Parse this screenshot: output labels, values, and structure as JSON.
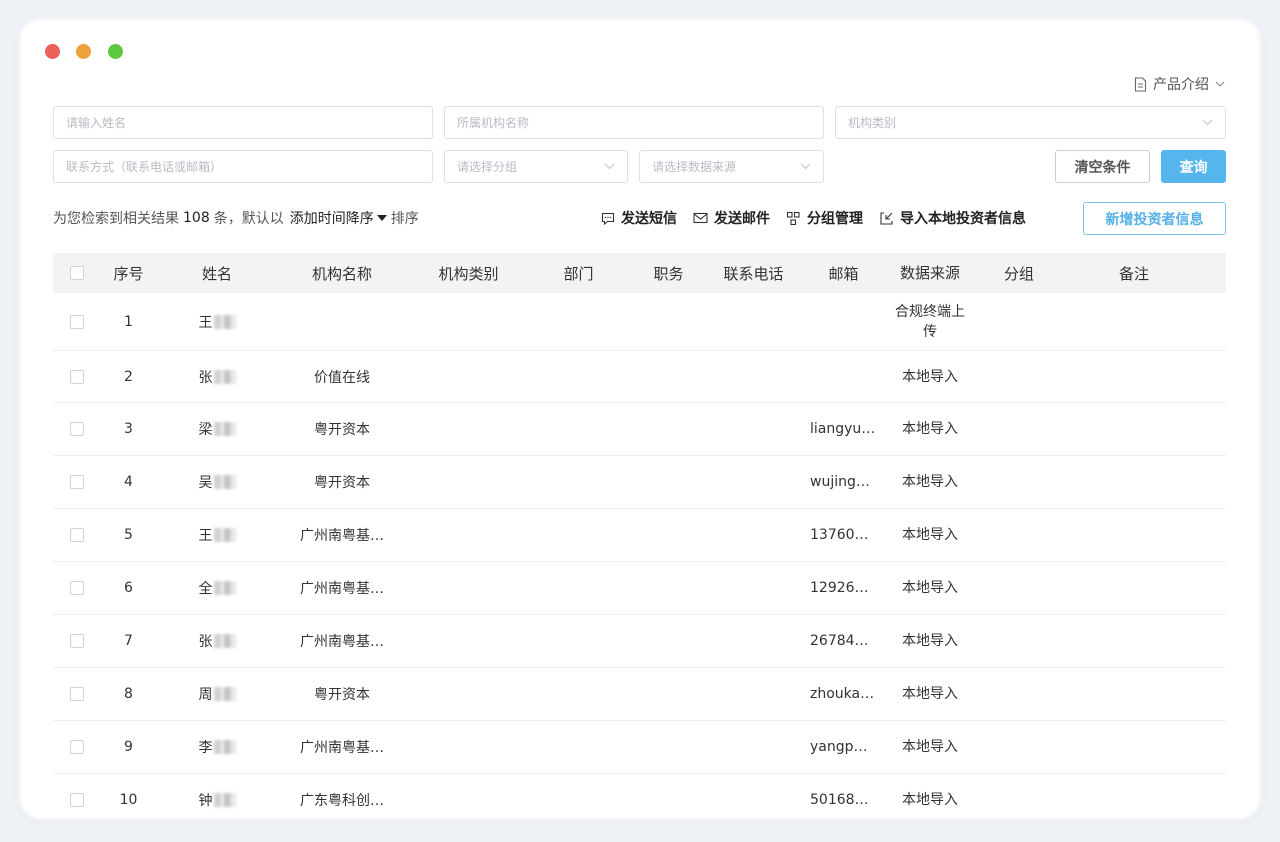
{
  "header": {
    "product_intro": "产品介绍"
  },
  "filters": {
    "name_placeholder": "请输入姓名",
    "org_placeholder": "所属机构名称",
    "org_type_placeholder": "机构类别",
    "contact_placeholder": "联系方式（联系电话或邮箱）",
    "group_placeholder": "请选择分组",
    "source_placeholder": "请选择数据来源",
    "clear_label": "清空条件",
    "query_label": "查询"
  },
  "summary": {
    "prefix": "为您检索到相关结果",
    "count": "108",
    "suffix": "条，默认以",
    "sort_field": "添加时间降序",
    "sort_suffix": "排序"
  },
  "actions": {
    "sms": "发送短信",
    "email": "发送邮件",
    "group": "分组管理",
    "import": "导入本地投资者信息",
    "add": "新增投资者信息"
  },
  "table": {
    "columns": [
      "序号",
      "姓名",
      "机构名称",
      "机构类别",
      "部门",
      "职务",
      "联系电话",
      "邮箱",
      "数据来源",
      "分组",
      "备注"
    ],
    "rows": [
      {
        "seq": "1",
        "name": "王",
        "org": "",
        "type": "",
        "dept": "",
        "pos": "",
        "tel": "",
        "mail": "",
        "src": "合规终端上传",
        "grp": "",
        "note": ""
      },
      {
        "seq": "2",
        "name": "张",
        "org": "价值在线",
        "type": "",
        "dept": "",
        "pos": "",
        "tel": "",
        "mail": "",
        "src": "本地导入",
        "grp": "",
        "note": ""
      },
      {
        "seq": "3",
        "name": "梁",
        "org": "粤开资本",
        "type": "",
        "dept": "",
        "pos": "",
        "tel": "",
        "mail": "liangyu…",
        "src": "本地导入",
        "grp": "",
        "note": ""
      },
      {
        "seq": "4",
        "name": "吴",
        "org": "粤开资本",
        "type": "",
        "dept": "",
        "pos": "",
        "tel": "",
        "mail": "wujing…",
        "src": "本地导入",
        "grp": "",
        "note": ""
      },
      {
        "seq": "5",
        "name": "王",
        "org": "广州南粤基…",
        "type": "",
        "dept": "",
        "pos": "",
        "tel": "",
        "mail": "13760…",
        "src": "本地导入",
        "grp": "",
        "note": ""
      },
      {
        "seq": "6",
        "name": "全",
        "org": "广州南粤基…",
        "type": "",
        "dept": "",
        "pos": "",
        "tel": "",
        "mail": "12926…",
        "src": "本地导入",
        "grp": "",
        "note": ""
      },
      {
        "seq": "7",
        "name": "张",
        "org": "广州南粤基…",
        "type": "",
        "dept": "",
        "pos": "",
        "tel": "",
        "mail": "26784…",
        "src": "本地导入",
        "grp": "",
        "note": ""
      },
      {
        "seq": "8",
        "name": "周",
        "org": "粤开资本",
        "type": "",
        "dept": "",
        "pos": "",
        "tel": "",
        "mail": "zhouka…",
        "src": "本地导入",
        "grp": "",
        "note": ""
      },
      {
        "seq": "9",
        "name": "李",
        "org": "广州南粤基…",
        "type": "",
        "dept": "",
        "pos": "",
        "tel": "",
        "mail": "yangp…",
        "src": "本地导入",
        "grp": "",
        "note": ""
      },
      {
        "seq": "10",
        "name": "钟",
        "org": "广东粤科创…",
        "type": "",
        "dept": "",
        "pos": "",
        "tel": "",
        "mail": "50168…",
        "src": "本地导入",
        "grp": "",
        "note": ""
      }
    ]
  }
}
